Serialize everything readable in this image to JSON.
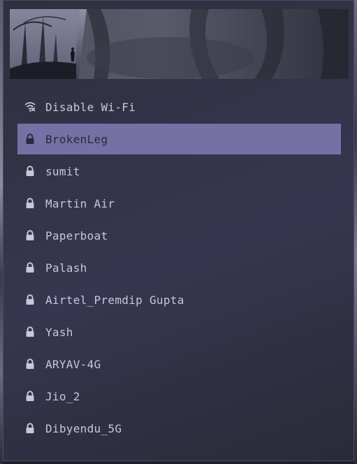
{
  "colors": {
    "menu_bg": "#33334a",
    "selected_bg": "#7670a4",
    "text": "#c9c6dc",
    "selected_text": "#2b2940"
  },
  "wifi_menu": {
    "disable_item": {
      "label": "Disable Wi-Fi",
      "icon": "wifi-off-icon"
    },
    "networks": [
      {
        "name": "BrokenLeg",
        "icon": "lock-icon",
        "selected": true
      },
      {
        "name": "sumit",
        "icon": "lock-icon",
        "selected": false
      },
      {
        "name": "Martin Air",
        "icon": "lock-icon",
        "selected": false
      },
      {
        "name": "Paperboat",
        "icon": "lock-icon",
        "selected": false
      },
      {
        "name": "Palash",
        "icon": "lock-icon",
        "selected": false
      },
      {
        "name": "Airtel_Premdip Gupta",
        "icon": "lock-icon",
        "selected": false
      },
      {
        "name": "Yash",
        "icon": "lock-icon",
        "selected": false
      },
      {
        "name": "ARYAV-4G",
        "icon": "lock-icon",
        "selected": false
      },
      {
        "name": "Jio_2",
        "icon": "lock-icon",
        "selected": false
      },
      {
        "name": "Dibyendu_5G",
        "icon": "lock-icon",
        "selected": false
      }
    ]
  }
}
